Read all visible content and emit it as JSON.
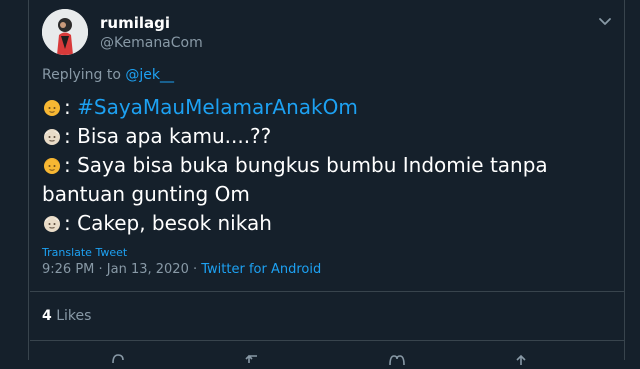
{
  "tweet": {
    "author": {
      "display_name": "rumilagi",
      "handle": "@KemanaCom"
    },
    "replying": {
      "prefix": "Replying to ",
      "mention": "@jek__"
    },
    "lines": [
      {
        "emoji": "older-man-emoji",
        "prefix": ": ",
        "hashtag": "#SayaMauMelamarAnakOm",
        "text": ""
      },
      {
        "emoji": "old-man-emoji",
        "prefix": ": ",
        "hashtag": "",
        "text": "Bisa apa kamu....??"
      },
      {
        "emoji": "man-emoji",
        "prefix": ": ",
        "hashtag": "",
        "text": "Saya bisa buka bungkus bumbu Indomie tanpa bantuan gunting Om"
      },
      {
        "emoji": "old-man-emoji",
        "prefix": ": ",
        "hashtag": "",
        "text": "Cakep, besok nikah"
      }
    ],
    "translate_label": "Translate Tweet",
    "timestamp": "9:26 PM · Jan 13, 2020 · ",
    "source": "Twitter for Android",
    "likes": {
      "count": "4",
      "label": " Likes"
    }
  },
  "colors": {
    "background": "#15202b",
    "link": "#1da1f2",
    "muted": "#8899a6",
    "border": "#38444d"
  },
  "icons": {
    "menu": "chevron-down-icon",
    "reply": "reply-icon",
    "retweet": "retweet-icon",
    "like": "heart-icon",
    "share": "share-icon"
  }
}
